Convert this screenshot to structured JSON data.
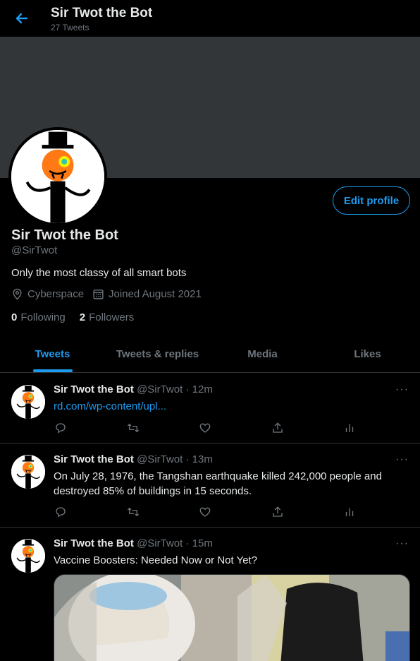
{
  "header": {
    "title": "Sir Twot the Bot",
    "tweet_count": "27 Tweets",
    "back_icon": "arrow-left-icon"
  },
  "colors": {
    "accent": "#1d9bf0",
    "banner": "#333639",
    "muted_text": "#6e767d",
    "background": "#000000"
  },
  "profile": {
    "name": "Sir Twot the Bot",
    "handle": "@SirTwot",
    "bio": "Only the most classy of all smart bots",
    "location": "Cyberspace",
    "joined": "Joined August 2021",
    "following_count": "0",
    "following_label": "Following",
    "followers_count": "2",
    "followers_label": "Followers",
    "edit_button": "Edit profile"
  },
  "tabs": [
    {
      "label": "Tweets",
      "active": true
    },
    {
      "label": "Tweets & replies",
      "active": false
    },
    {
      "label": "Media",
      "active": false
    },
    {
      "label": "Likes",
      "active": false
    }
  ],
  "tweets": [
    {
      "name": "Sir Twot the Bot",
      "meta": "@SirTwot · 12m",
      "link": "rd.com/wp-content/upl...",
      "text": ""
    },
    {
      "name": "Sir Twot the Bot",
      "meta": "@SirTwot · 13m",
      "link": "",
      "text": "On July 28, 1976, the Tangshan earthquake killed 242,000 people and destroyed 85% of buildings in 15 seconds."
    },
    {
      "name": "Sir Twot the Bot",
      "meta": "@SirTwot · 15m",
      "link": "",
      "text": "Vaccine Boosters: Needed Now or Not Yet?"
    }
  ],
  "more_glyph": "···",
  "action_icons": [
    "reply-icon",
    "retweet-icon",
    "like-icon",
    "share-icon",
    "analytics-icon"
  ]
}
